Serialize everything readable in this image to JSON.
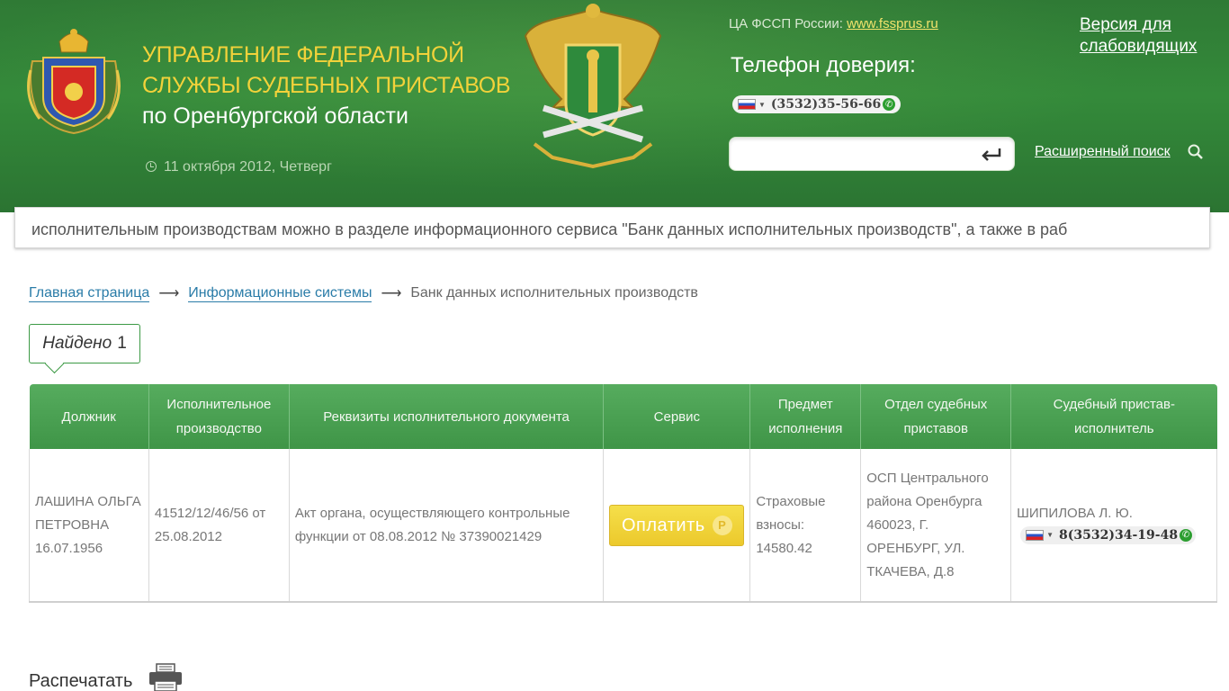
{
  "header": {
    "title_line1": "УПРАВЛЕНИЕ ФЕДЕРАЛЬНОЙ",
    "title_line2": "СЛУЖБЫ СУДЕБНЫХ ПРИСТАВОВ",
    "title_line3": "по Оренбургской области",
    "date": "11 октября 2012, Четверг",
    "central_prefix": "ЦА ФССП России: ",
    "central_link": "www.fssprus.ru",
    "trust_label": "Телефон доверия:",
    "trust_phone": "(3532)35-56-66",
    "low_vision_line1": "Версия для",
    "low_vision_line2": "слабовидящих",
    "search_value": "",
    "advanced_search": "Расширенный поиск"
  },
  "ticker": {
    "text": "исполнительным производствам можно в разделе информационного сервиса \"Банк данных исполнительных производств\", а также в раб"
  },
  "breadcrumb": {
    "home": "Главная страница",
    "section": "Информационные системы",
    "current": "Банк данных исполнительных производств",
    "separator": "⟶"
  },
  "found": {
    "label": "Найдено",
    "count": "1"
  },
  "table": {
    "headers": [
      "Должник",
      "Исполнительное производство",
      "Реквизиты исполнительного документа",
      "Сервис",
      "Предмет исполнения",
      "Отдел судебных приставов",
      "Судебный пристав-исполнитель"
    ],
    "row": {
      "debtor": "ЛАШИНА ОЛЬГА ПЕТРОВНА 16.07.1956",
      "proceeding": "41512/12/46/56 от 25.08.2012",
      "document": "Акт органа, осуществляющего контрольные функции от 08.08.2012 № 37390021429",
      "pay_label": "Оплатить",
      "ruble": "Р",
      "subject": "Страховые взносы: 14580.42",
      "department": "ОСП Центрального района Оренбурга 460023, Г. ОРЕНБУРГ, УЛ. ТКАЧЕВА, Д.8",
      "bailiff": "ШИПИЛОВА Л. Ю.",
      "bailiff_phone": "8(3532)34-19-48"
    }
  },
  "print_label": "Распечатать",
  "colors": {
    "header_green": "#348a3a",
    "title_yellow": "#f2d23a",
    "link_blue": "#2a7ca8",
    "pay_yellow": "#ecc92c"
  },
  "icons": [
    "regional-emblem",
    "fssp-emblem",
    "clock-icon",
    "flag-ru-icon",
    "phone-call-icon",
    "enter-icon",
    "magnifier-icon",
    "ruble-icon",
    "printer-icon"
  ]
}
